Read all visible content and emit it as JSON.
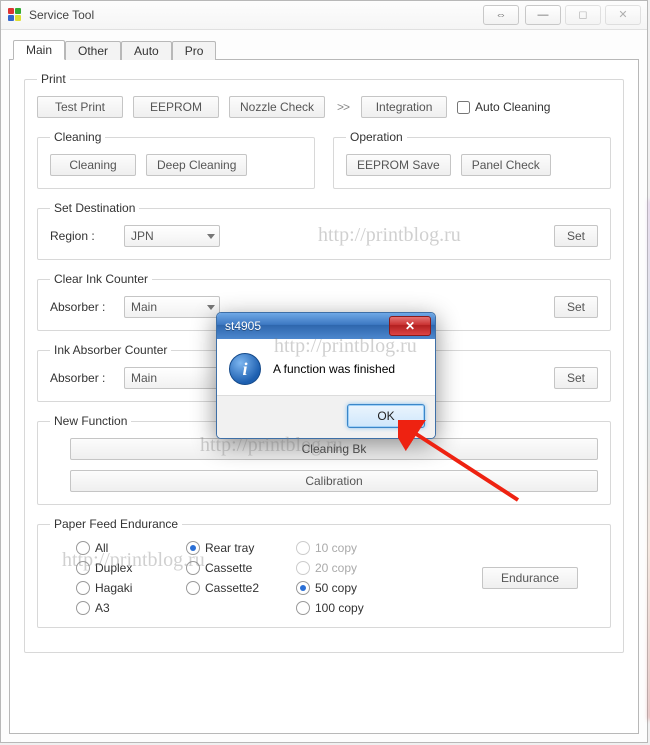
{
  "window": {
    "title": "Service Tool",
    "controls": {
      "swap": "⇔",
      "min": "—",
      "max": "◻",
      "close": "✕"
    }
  },
  "tabs": [
    "Main",
    "Other",
    "Auto",
    "Pro"
  ],
  "active_tab": 0,
  "print": {
    "legend": "Print",
    "buttons": [
      "Test Print",
      "EEPROM",
      "Nozzle Check",
      "Integration"
    ],
    "arrows": ">>",
    "auto_cleaning_label": "Auto Cleaning",
    "auto_cleaning_checked": false
  },
  "cleaning": {
    "legend": "Cleaning",
    "buttons": [
      "Cleaning",
      "Deep Cleaning"
    ]
  },
  "operation": {
    "legend": "Operation",
    "buttons": [
      "EEPROM Save",
      "Panel Check"
    ]
  },
  "set_destination": {
    "legend": "Set Destination",
    "label": "Region :",
    "value": "JPN",
    "set": "Set"
  },
  "clear_ink": {
    "legend": "Clear Ink Counter",
    "label": "Absorber :",
    "value": "Main",
    "set": "Set"
  },
  "ink_absorber": {
    "legend": "Ink Absorber Counter",
    "label": "Absorber :",
    "value": "Main",
    "set": "Set"
  },
  "new_function": {
    "legend": "New Function",
    "buttons": [
      "Cleaning Bk",
      "Calibration"
    ]
  },
  "paper_feed": {
    "legend": "Paper Feed Endurance",
    "col1": [
      "All",
      "Duplex",
      "Hagaki",
      "A3"
    ],
    "col2": [
      "Rear tray",
      "Cassette",
      "Cassette2"
    ],
    "col3": [
      "10 copy",
      "20 copy",
      "50 copy",
      "100 copy"
    ],
    "selected": {
      "col2": 0,
      "col3": 2
    },
    "endurance": "Endurance"
  },
  "dialog": {
    "title": "st4905",
    "message": "A function was finished",
    "ok": "OK",
    "close_glyph": "✕"
  },
  "watermarks": {
    "text": "http://printblog.ru"
  }
}
